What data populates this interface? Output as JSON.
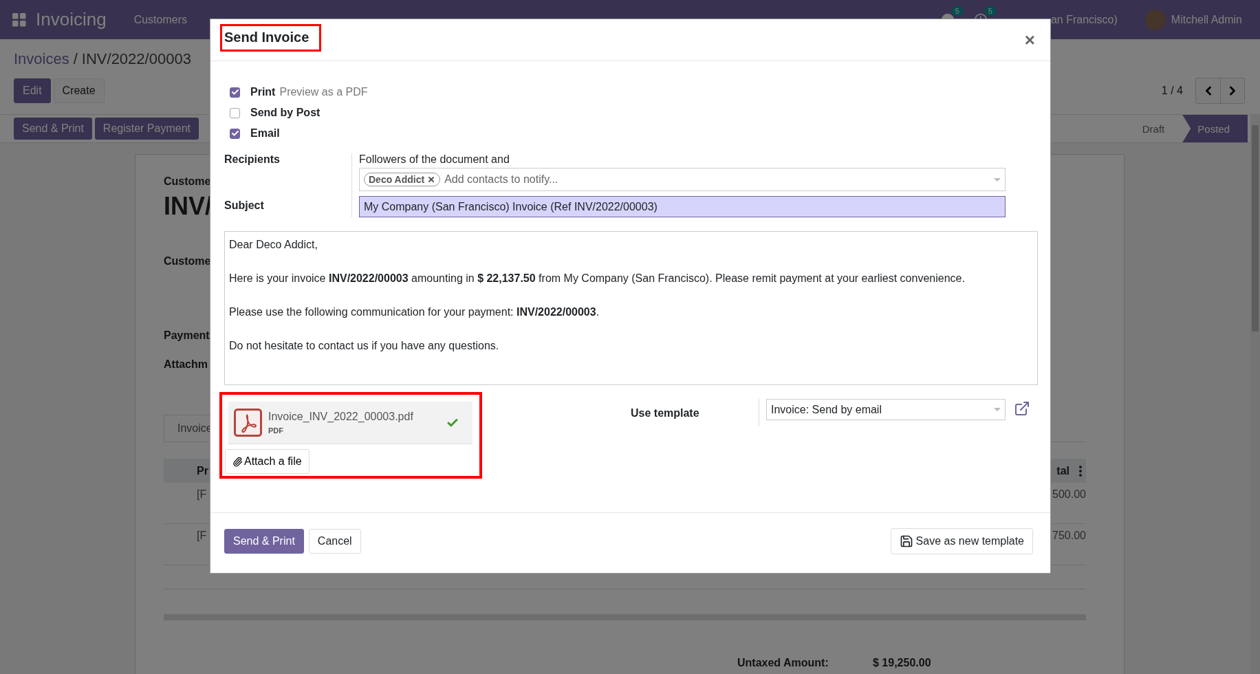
{
  "navbar": {
    "app_name": "Invoicing",
    "menu": [
      "Customers"
    ],
    "messages_badge": "5",
    "activities_badge": "5",
    "company": "an Francisco)",
    "user": "Mitchell Admin"
  },
  "breadcrumb": {
    "parent": "Invoices",
    "separator": "/",
    "current": "INV/2022/00003"
  },
  "control_buttons": [
    {
      "label": "Edit",
      "kind": "primary"
    },
    {
      "label": "Create",
      "kind": "secondary"
    }
  ],
  "pager": "1 / 4",
  "action_buttons": [
    "Send & Print",
    "Register Payment"
  ],
  "statuses": [
    {
      "label": "Draft",
      "selected": false
    },
    {
      "label": "Posted",
      "selected": true
    }
  ],
  "sheet": {
    "subtitle": "Custome",
    "title": "INV/",
    "labels": [
      "Custome",
      "Payment",
      "Attachm"
    ],
    "tab": "Invoice",
    "columns": [
      "Pr",
      "tal"
    ],
    "rows": [
      {
        "product": "[F",
        "total": "500.00"
      },
      {
        "product": "[F",
        "total": "750.00"
      }
    ],
    "totals": {
      "label": "Untaxed Amount:",
      "value": "$ 19,250.00"
    }
  },
  "dialog": {
    "title": "Send Invoice",
    "close": "×",
    "options": [
      {
        "label": "Print",
        "hint": "Preview as a PDF",
        "checked": true
      },
      {
        "label": "Send by Post",
        "checked": false
      },
      {
        "label": "Email",
        "checked": true
      }
    ],
    "recipients": {
      "label": "Recipients",
      "note": "Followers of the document and",
      "tags": [
        "Deco Addict"
      ],
      "placeholder": "Add contacts to notify..."
    },
    "subject": {
      "label": "Subject",
      "value": "My Company (San Francisco) Invoice (Ref INV/2022/00003)"
    },
    "body": [
      "Dear Deco Addict,",
      "Here is your invoice **INV/2022/00003** amounting in **$ 22,137.50** from My Company (San Francisco). Please remit payment at your earliest convenience.",
      "Please use the following communication for your payment: **INV/2022/00003**.",
      "Do not hesitate to contact us if you have any questions."
    ],
    "attachments": [
      {
        "name": "Invoice_INV_2022_00003.pdf",
        "type": "PDF",
        "uploaded": true
      }
    ],
    "attach_button": "Attach a file",
    "template": {
      "label": "Use template",
      "value": "Invoice: Send by email"
    },
    "footer": {
      "primary": "Send & Print",
      "cancel": "Cancel",
      "save_template": "Save as new template"
    }
  }
}
